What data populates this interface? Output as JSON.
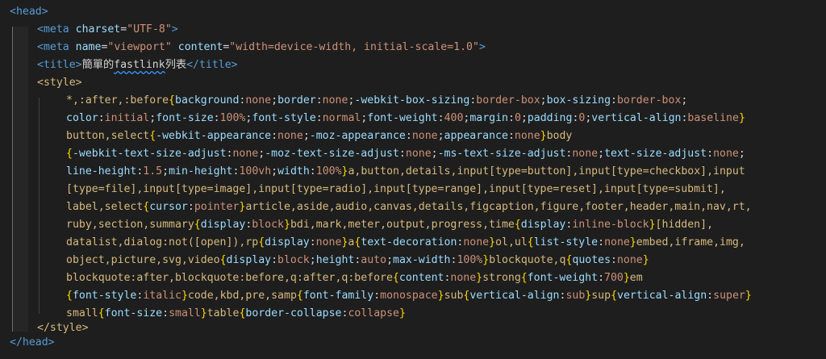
{
  "code": {
    "head_open": "<head>",
    "meta_charset": {
      "tag": "meta",
      "attr": "charset",
      "eq": "=",
      "val": "\"UTF-8\""
    },
    "meta_viewport": {
      "tag": "meta",
      "attr1": "name",
      "val1": "\"viewport\"",
      "attr2": "content",
      "val2": "\"width=device-width, initial-scale=1.0\""
    },
    "title": {
      "tag": "title",
      "text_pre": "簡單的",
      "text_squig": "fastlink",
      "text_post": "列表"
    },
    "style_open": "style",
    "style_close": "style",
    "head_close": "</head>",
    "css_lines": [
      "*,:after,:before{background:none;border:none;-webkit-box-sizing:border-box;box-sizing:border-box;",
      "color:initial;font-size:100%;font-style:normal;font-weight:400;margin:0;padding:0;vertical-align:baseline}",
      "button,select{-webkit-appearance:none;-moz-appearance:none;appearance:none}body",
      "{-webkit-text-size-adjust:none;-moz-text-size-adjust:none;-ms-text-size-adjust:none;text-size-adjust:none;",
      "line-height:1.5;min-height:100vh;width:100%}a,button,details,input[type=button],input[type=checkbox],input",
      "[type=file],input[type=image],input[type=radio],input[type=range],input[type=reset],input[type=submit],",
      "label,select{cursor:pointer}article,aside,audio,canvas,details,figcaption,figure,footer,header,main,nav,rt,",
      "ruby,section,summary{display:block}bdi,mark,meter,output,progress,time{display:inline-block}[hidden],",
      "datalist,dialog:not([open]),rp{display:none}a{text-decoration:none}ol,ul{list-style:none}embed,iframe,img,",
      "object,picture,svg,video{display:block;height:auto;max-width:100%}blockquote,q{quotes:none}",
      "blockquote:after,blockquote:before,q:after,q:before{content:none}strong{font-weight:700}em",
      "{font-style:italic}code,kbd,pre,samp{font-family:monospace}sub{vertical-align:sub}sup{vertical-align:super}",
      "small{font-size:small}table{border-collapse:collapse}"
    ]
  },
  "colors": {
    "background": "#1e1e1e",
    "tag": "#569cd6",
    "attribute": "#9cdcfe",
    "string": "#ce9178",
    "selector": "#d7ba7d",
    "brace": "#ffd700"
  }
}
